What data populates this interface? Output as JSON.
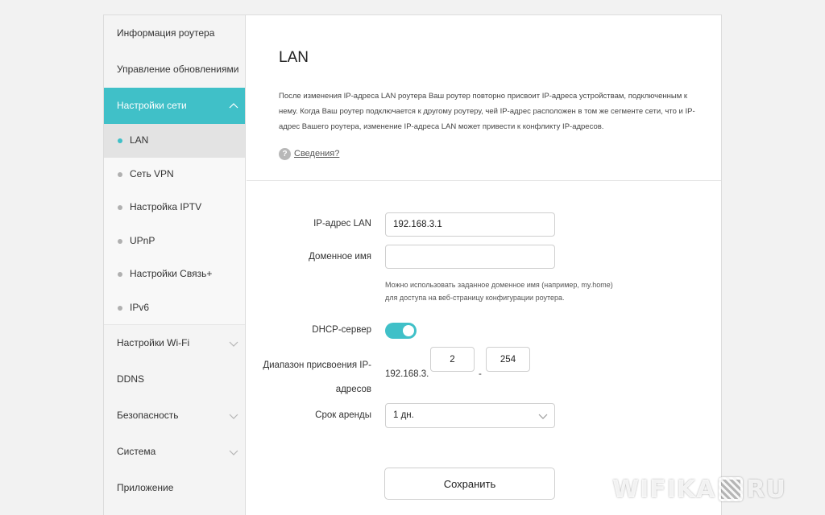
{
  "sidebar": {
    "items": [
      {
        "label": "Информация роутера"
      },
      {
        "label": "Управление обновлениями"
      },
      {
        "label": "Настройки сети"
      }
    ],
    "network_sub": [
      {
        "label": "LAN"
      },
      {
        "label": "Сеть VPN"
      },
      {
        "label": "Настройка IPTV"
      },
      {
        "label": "UPnP"
      },
      {
        "label": "Настройки Связь+"
      },
      {
        "label": "IPv6"
      }
    ],
    "bottom_items": [
      {
        "label": "Настройки Wi-Fi"
      },
      {
        "label": "DDNS"
      },
      {
        "label": "Безопасность"
      },
      {
        "label": "Система"
      },
      {
        "label": "Приложение"
      }
    ]
  },
  "main": {
    "title": "LAN",
    "description": "После изменения IP-адреса LAN роутера Ваш роутер повторно присвоит IP-адреса устройствам, подключенным к нему. Когда Ваш роутер подключается к другому роутеру, чей IP-адрес расположен в том же сегменте сети, что и IP-адрес Вашего роутера, изменение IP-адреса LAN может привести к конфликту IP-адресов.",
    "details_link": "Сведения?"
  },
  "form": {
    "ip_label": "IP-адрес LAN",
    "ip_value": "192.168.3.1",
    "domain_label": "Доменное имя",
    "domain_value": "",
    "domain_hint": "Можно использовать заданное доменное имя (например, my.home) для доступа на веб-страницу конфигурации роутера.",
    "dhcp_label": "DHCP-сервер",
    "dhcp_enabled": true,
    "range_label": "Диапазон присвоения IP-адресов",
    "range_prefix": "192.168.3.",
    "range_start": "2",
    "range_separator": "-",
    "range_end": "254",
    "lease_label": "Срок аренды",
    "lease_value": "1 дн.",
    "save_label": "Сохранить"
  },
  "watermark": {
    "left": "WIFIKA",
    "right": "RU"
  },
  "colors": {
    "accent": "#40c0c8"
  }
}
